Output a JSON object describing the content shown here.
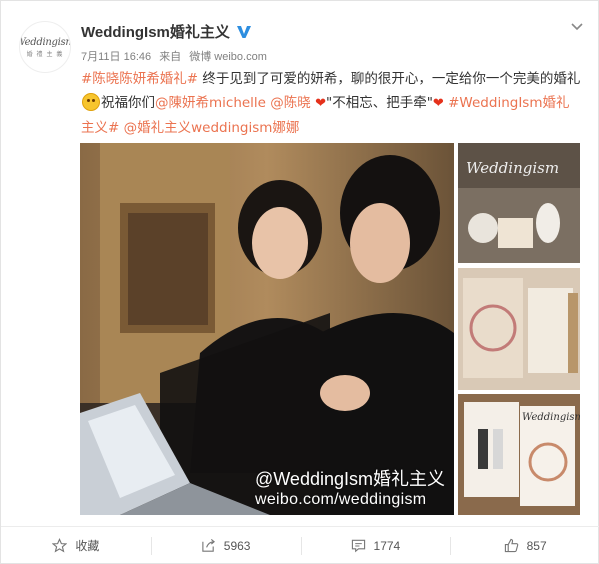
{
  "post": {
    "username": "WeddingIsm婚礼主义",
    "avatar": {
      "logo_text": "Weddingism",
      "logo_cn": "婚 禮 主 義"
    },
    "date": "7月11日 16:46",
    "source_prefix": "来自",
    "source": "微博 weibo.com",
    "text": {
      "tag1": "#陈晓陈妍希婚礼#",
      "seg1": " 终于见到了可爱的妍希，聊的很开心，一定给你一个完美的婚礼",
      "seg2": "祝福你们",
      "mention1": "@陳妍希michelle",
      "mention2": "@陈晓",
      "quote": "\"不相忘、把手牵\"",
      "tag2": "#WeddingIsm婚礼主义#",
      "mention3": "@婚礼主义weddingism娜娜"
    },
    "watermark": {
      "line1": "@WeddingIsm婚礼主义",
      "line2": "weibo.com/weddingism"
    },
    "thumb_texts": {
      "t1": "Weddingism",
      "t3": "Weddingism"
    }
  },
  "actions": [
    {
      "icon": "star-icon",
      "label": "收藏"
    },
    {
      "icon": "share-icon",
      "label": "5963"
    },
    {
      "icon": "comment-icon",
      "label": "1774"
    },
    {
      "icon": "like-icon",
      "label": "857"
    }
  ],
  "colors": {
    "link": "#eb7350",
    "verified": "#2d8ee0",
    "heart": "#e5311b"
  }
}
